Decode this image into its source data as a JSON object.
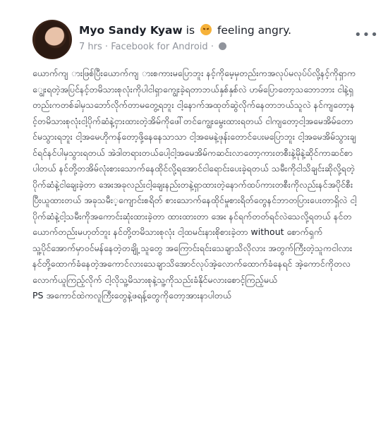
{
  "post": {
    "author": "Myo Sandy Kyaw",
    "feeling_prefix": "is",
    "feeling": "feeling angry.",
    "time": "7 hrs",
    "separator": "·",
    "source": "Facebook for Android",
    "separator2": "·",
    "icons": {
      "more": "more-options-icon",
      "emoji": "angry-face-icon",
      "privacy": "globe-icon"
    }
  },
  "body": {
    "paragraph_1": "ယောက်ကျ ားဖြစ်ပြီးယောက်ကျ ားစကားမပြောဘူး နင့်ကိုမေ့မှတည်းကအလုပ်မလုပ်ပ်လို့နင့်ကိုရှာကျွေးရတဲ့အပြင်နင့်တမိသားစုလုံးကိုပါငါရှာကျွေးခဲ့ရတာဘယ်နှစ်နှစ်လဲ ဟမ်ပြောတော့သဘောဘား ငါနဲ့ရှတည်းကတစ်ခါမှသဘော်လိုက်တာမတွေ့ရဘူး ငါ့နောက်အထုတ်ဆွဲလိုက်နေတာဘယ်သူလဲ နင်ကျတော့နင့်တမိသားစုလုံးငါ့ပိုက်ဆံနဲ့ငှားထားတဲ့အိမ်ကိုဖေါ်တင်ကျွေးမွေးထားရတယ် ငါကျတော့ငါ့အမေအိမ်တောင်မသွားရဘူး ငါ့အမေဟိုကန်တော့ဖို့နေနေသာသာ ငါ့အမေနဲ့ဖုန်းတောင်ပေးမပြောဘူး ငါ့အမေအိမ်သွားချင်ရင်နင်ပါမှသွားရတယ် အဲဒါတရားတယ်ပေါ့ငါ့အမေအိမ်ကဆင်းလာတော့ကားတစီးနဲ့မိုနဲ့ဆိုင်ကာဆင်စာပါတယ် နင်တို့တအိမ်လုံးစားသောက်နေထိုင်လို့ရအောင်ငါရောင်းပေးခဲ့ရတယ် သမီးကိုငါသိချင်းဆိုလို့ရတဲ့ပိုက်ဆံနဲ့ငါချေးခဲ့တာ အေးအခုလည်းငါ့ချေးနည်းတနဲ့ရှာထားတဲ့နောက်ထပ်ကားတစီးကိုလည်းနင်အပိုင်စီးပြီးယူထားတယ် အခုသမီး့ကျောင်းစရိတ် စားသောက်နေထိုင်မှုစားရိတ်တွေနင်ဘာတပြားပေးတာရှိလဲ ငါ့ပိုက်ဆံနဲ့ငါ့သမီးကိုအကောင်းဆုံးထားခဲ့တာ ထားထားတာ အေး နင်ရက်တတ်ရင်လဲသေလို့ရတယ် နင်တယောက်တည်းမဟုတ်ဘူး နင်တို့တမိသားစုလုံး ငါ့ထမင်းနားစိုစားခဲ့တာ without စောက်ရှက်",
    "paragraph_2": "သူ့ပိုင်အောက်မှာဝင်မန်နေတဲ့တချို့ သူတွေ အကြောင်းရင်းသေချာသိလိုလား အတွက်ကြီးတဲ့သူကငါလား နင်တို့ထောက်ခံနေတဲ့အကောင်လားသေချာသိအောင်လုပ်အဲ့လောက်ထောက်ခံနေရင် အဲ့ကောင်ကိုတလလောက်ယူကြည့်လိုက် ငါ့လိုသူ့မိသားစုနဲ့သူ့ကိုသည်းခံနိုင်မလားစောင့်ကြည့်မယ်",
    "paragraph_3": "PS အကောင်ထဲကလူကြီးတွေနဲ့ဖရန့်တွေကိုတော့အားနာပါတယ်"
  }
}
